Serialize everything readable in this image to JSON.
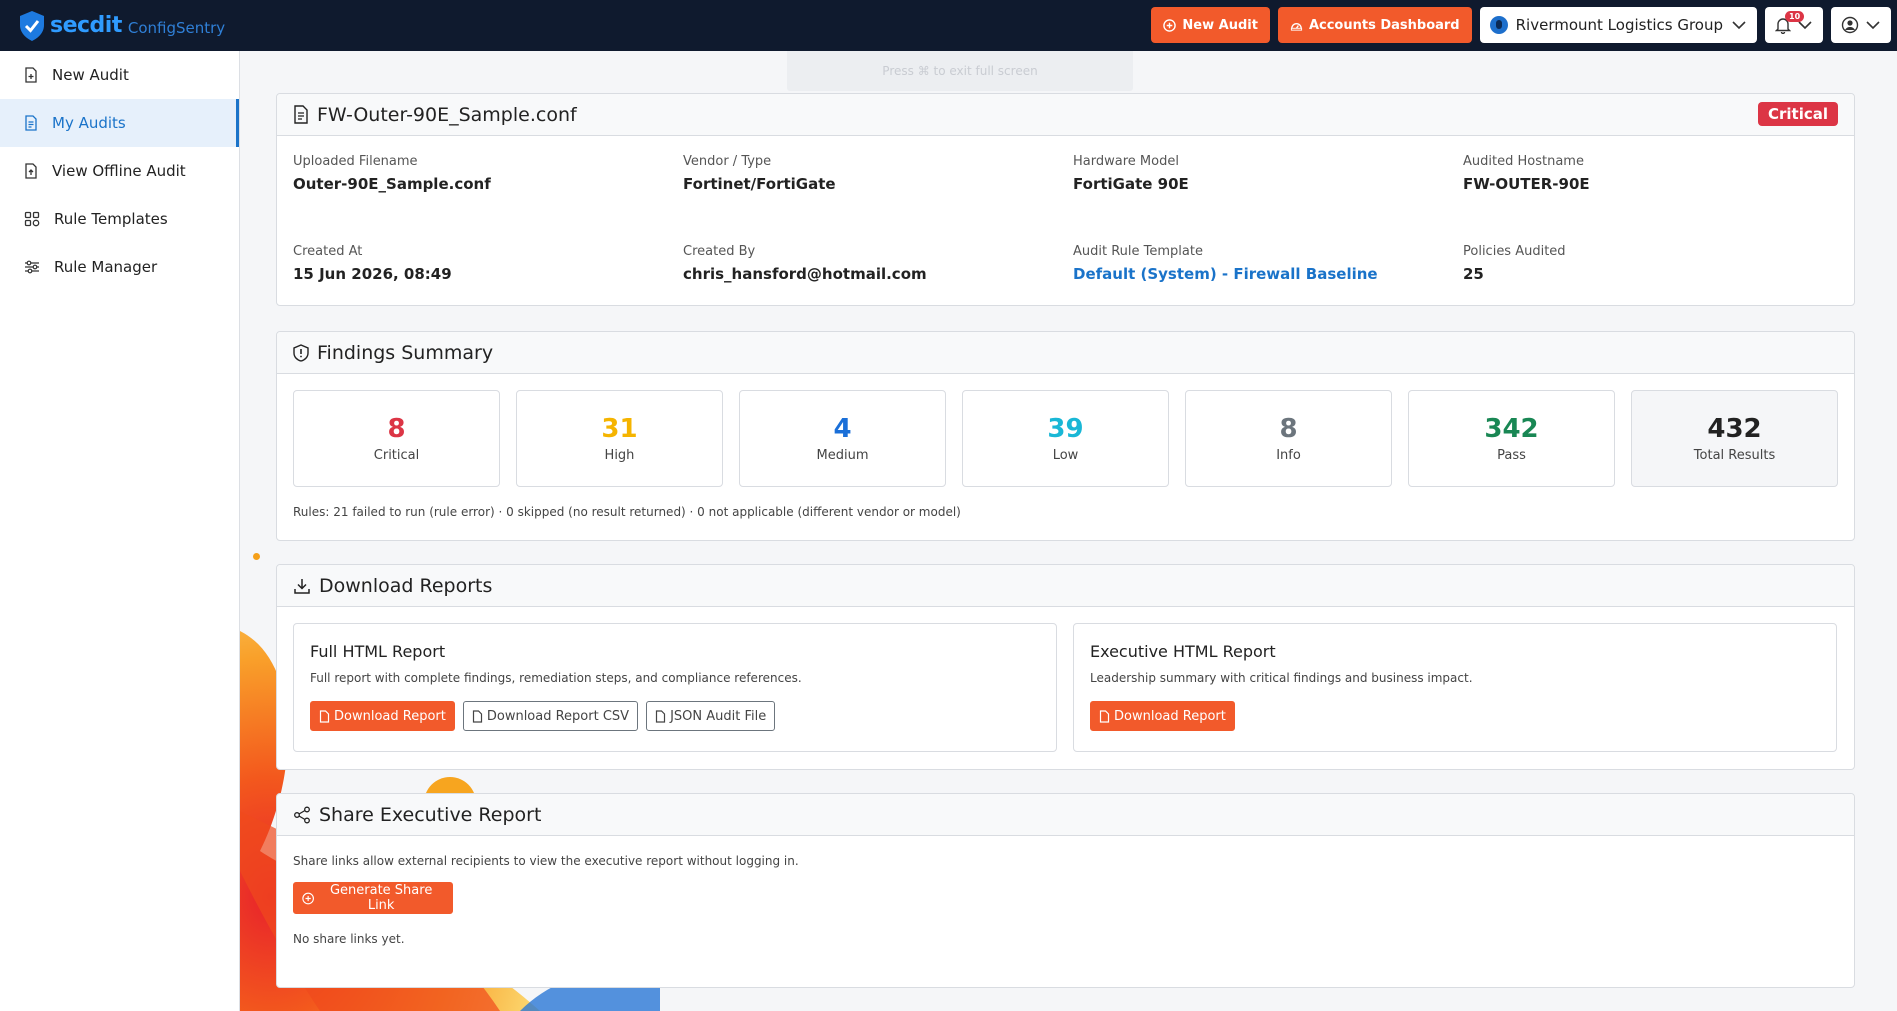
{
  "brand": {
    "name": "secdit",
    "product": "ConfigSentry"
  },
  "topbar": {
    "new_audit": "New Audit",
    "accounts_dashboard": "Accounts Dashboard",
    "org_name": "Rivermount Logistics Group",
    "notification_count": "10"
  },
  "sidebar": {
    "items": [
      {
        "label": "New Audit",
        "icon": "file-plus-icon",
        "active": false
      },
      {
        "label": "My Audits",
        "icon": "document-icon",
        "active": true
      },
      {
        "label": "View Offline Audit",
        "icon": "file-upload-icon",
        "active": false
      },
      {
        "label": "Rule Templates",
        "icon": "grid-icon",
        "active": false
      },
      {
        "label": "Rule Manager",
        "icon": "sliders-icon",
        "active": false
      }
    ]
  },
  "toast": "Press ⌘ to exit full screen",
  "audit": {
    "title": "FW-Outer-90E_Sample.conf",
    "severity": "Critical",
    "fields": [
      {
        "key": "Uploaded Filename",
        "value": "Outer-90E_Sample.conf"
      },
      {
        "key": "Vendor / Type",
        "value": "Fortinet/FortiGate"
      },
      {
        "key": "Hardware Model",
        "value": "FortiGate 90E"
      },
      {
        "key": "Audited Hostname",
        "value": "FW-OUTER-90E"
      },
      {
        "key": "Created At",
        "value": "15 Jun 2026, 08:49"
      },
      {
        "key": "Created By",
        "value": "chris_hansford@hotmail.com"
      },
      {
        "key": "Audit Rule Template",
        "value": "Default (System) - Firewall Baseline"
      },
      {
        "key": "Policies Audited",
        "value": "25"
      }
    ]
  },
  "findings": {
    "title": "Findings Summary",
    "stats": [
      {
        "value": "8",
        "label": "Critical",
        "color": "#dc3545"
      },
      {
        "value": "31",
        "label": "High",
        "color": "#f5b400"
      },
      {
        "value": "4",
        "label": "Medium",
        "color": "#1a6fd8"
      },
      {
        "value": "39",
        "label": "Low",
        "color": "#19b7d6"
      },
      {
        "value": "8",
        "label": "Info",
        "color": "#6c757d"
      },
      {
        "value": "342",
        "label": "Pass",
        "color": "#198754"
      },
      {
        "value": "432",
        "label": "Total Results",
        "color": "#222222"
      }
    ],
    "rules_note": "Rules: 21 failed to run (rule error) · 0 skipped (no result returned) · 0 not applicable (different vendor or model)"
  },
  "downloads": {
    "title": "Download Reports",
    "full": {
      "title": "Full HTML Report",
      "desc": "Full report with complete findings, remediation steps, and compliance references.",
      "btn_report": "Download Report",
      "btn_csv": "Download Report CSV",
      "btn_json": "JSON Audit File"
    },
    "exec": {
      "title": "Executive HTML Report",
      "desc": "Leadership summary with critical findings and business impact.",
      "btn_report": "Download Report"
    }
  },
  "share": {
    "title": "Share Executive Report",
    "desc": "Share links allow external recipients to view the executive report without logging in.",
    "btn": "Generate Share Link",
    "empty": "No share links yet."
  }
}
